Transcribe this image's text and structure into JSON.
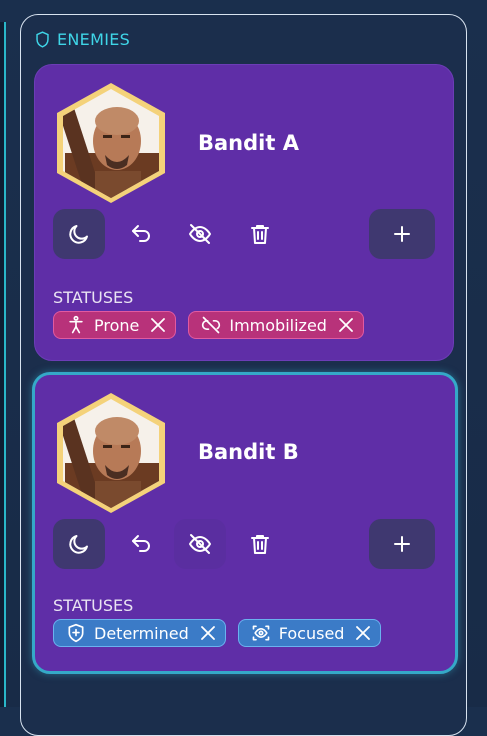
{
  "header": {
    "title": "ENEMIES"
  },
  "colors": {
    "accent": "#3fd6e8",
    "card": "#5f2ea7",
    "negative_status": "#b8327a",
    "positive_status": "#3b7bc7",
    "selected_border": "#35a9c8"
  },
  "labels": {
    "statuses": "STATUSES"
  },
  "enemies": [
    {
      "name": "Bandit A",
      "selected": false,
      "statuses": [
        {
          "label": "Prone",
          "icon": "person-standing-icon",
          "kind": "negative"
        },
        {
          "label": "Immobilized",
          "icon": "unlink-icon",
          "kind": "negative"
        }
      ]
    },
    {
      "name": "Bandit B",
      "selected": true,
      "statuses": [
        {
          "label": "Determined",
          "icon": "shield-plus-icon",
          "kind": "positive"
        },
        {
          "label": "Focused",
          "icon": "eye-scan-icon",
          "kind": "positive"
        }
      ]
    }
  ],
  "toolbar": {
    "rest": "moon-icon",
    "undo": "undo-icon",
    "hide": "eye-off-icon",
    "delete": "trash-icon",
    "add": "plus-icon"
  }
}
